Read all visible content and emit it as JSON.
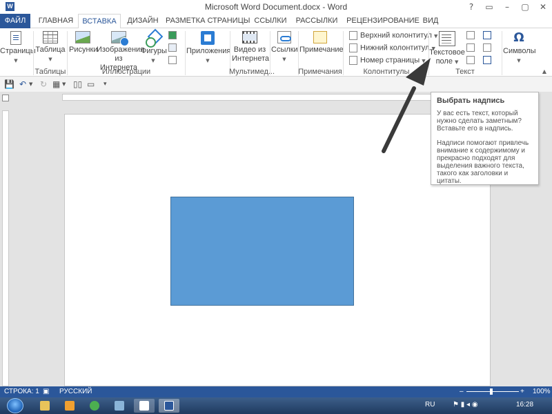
{
  "window": {
    "title": "Microsoft Word Document.docx - Word",
    "app_icon": "W",
    "controls": [
      "?",
      "▭",
      "–",
      "▢",
      "✕"
    ]
  },
  "tabs": [
    {
      "label": "ФАЙЛ"
    },
    {
      "label": "ГЛАВНАЯ"
    },
    {
      "label": "ВСТАВКА"
    },
    {
      "label": "ДИЗАЙН"
    },
    {
      "label": "РАЗМЕТКА СТРАНИЦЫ"
    },
    {
      "label": "ССЫЛКИ"
    },
    {
      "label": "РАССЫЛКИ"
    },
    {
      "label": "РЕЦЕНЗИРОВАНИЕ"
    },
    {
      "label": "ВИД"
    }
  ],
  "active_tab": "ВСТАВКА",
  "ribbon": {
    "pages": "Страницы",
    "table": "Таблица",
    "tables_group": "Таблицы",
    "pictures": "Рисунки",
    "online_pictures_1": "Изображения",
    "online_pictures_2": "из Интернета",
    "shapes": "Фигуры",
    "illustrations_group": "Иллюстрации",
    "apps": "Приложения",
    "online_video_1": "Видео из",
    "online_video_2": "Интернета",
    "media_group": "Мультимед...",
    "links": "Ссылки",
    "comment": "Примечание",
    "comments_group": "Примечания",
    "header": "Верхний колонтитул",
    "footer": "Нижний колонтитул",
    "page_number": "Номер страницы",
    "header_footer_group": "Колонтитулы",
    "textbox_1": "Текстовое",
    "textbox_2": "поле",
    "text_group": "Текст",
    "symbols": "Символы"
  },
  "tooltip": {
    "title": "Выбрать надпись",
    "para1": "У вас есть текст, который нужно сделать заметным? Вставьте его в надпись.",
    "para2": "Надписи помогают привлечь внимание к содержимому и прекрасно подходят для выделения важного текста, такого как заголовки и цитаты."
  },
  "status": {
    "page": "СТРОКА: 1",
    "language": "РУССКИЙ",
    "zoom": "100%",
    "zoom_minus": "–",
    "zoom_plus": "+"
  },
  "taskbar": {
    "lang": "RU",
    "time": "16:28"
  },
  "colors": {
    "accent": "#2b579a",
    "shape_fill": "#5b9bd5",
    "shape_border": "#41719c"
  }
}
